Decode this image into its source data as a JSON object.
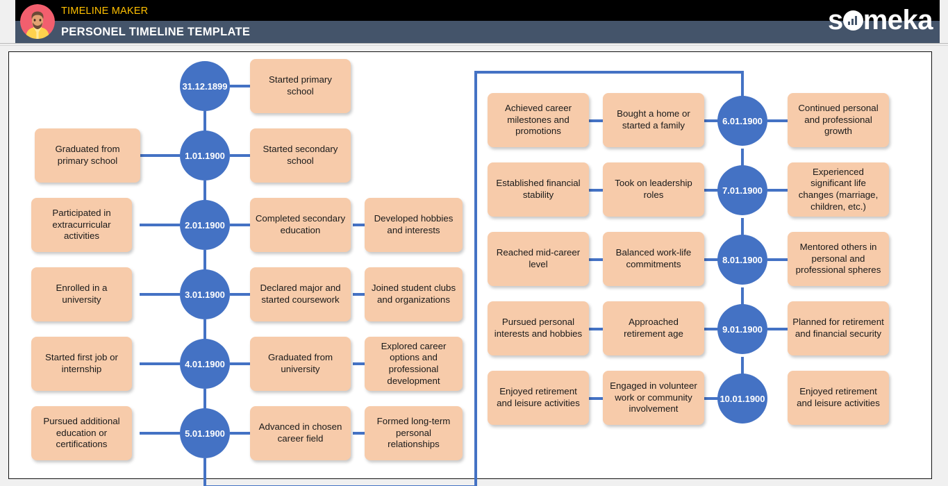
{
  "header": {
    "kicker": "TIMELINE MAKER",
    "title": "PERSONEL TIMELINE TEMPLATE",
    "brand_pre": "s",
    "brand_post": "meka",
    "avatar_icon": "user-avatar-icon",
    "colors": {
      "kicker": "#ffc000",
      "top_bar": "#000000",
      "title_bar": "#44546a",
      "brand_text": "#ffffff"
    }
  },
  "theme": {
    "node_fill": "#4472c4",
    "node_text": "#ffffff",
    "box_fill": "#f7cbaa",
    "box_text": "#1a1a1a",
    "connector": "#4472c4",
    "canvas": "#ffffff",
    "page": "#f0f0f0"
  },
  "timeline": {
    "left_column": [
      {
        "date": "31.12.1899",
        "left_box": "",
        "right_boxes": [
          "Started primary school"
        ]
      },
      {
        "date": "1.01.1900",
        "left_box": "Graduated from primary school",
        "right_boxes": [
          "Started secondary school"
        ]
      },
      {
        "date": "2.01.1900",
        "left_box": "Participated in extracurricular activities",
        "right_boxes": [
          "Completed secondary education",
          "Developed hobbies and interests"
        ]
      },
      {
        "date": "3.01.1900",
        "left_box": "Enrolled in a university",
        "right_boxes": [
          "Declared major and started coursework",
          "Joined student clubs and organizations"
        ]
      },
      {
        "date": "4.01.1900",
        "left_box": "Started first job or internship",
        "right_boxes": [
          "Graduated from university",
          "Explored career options and professional development"
        ]
      },
      {
        "date": "5.01.1900",
        "left_box": "Pursued additional education or certifications",
        "right_boxes": [
          "Advanced in chosen career field",
          "Formed long-term personal relationships"
        ]
      }
    ],
    "right_column": [
      {
        "date": "6.01.1900",
        "left_boxes": [
          "Achieved career milestones and promotions",
          "Bought a home or started a family"
        ],
        "right_box": "Continued personal and professional growth"
      },
      {
        "date": "7.01.1900",
        "left_boxes": [
          "Established financial stability",
          "Took on leadership roles"
        ],
        "right_box": "Experienced significant life changes (marriage, children, etc.)"
      },
      {
        "date": "8.01.1900",
        "left_boxes": [
          "Reached mid-career level",
          "Balanced work-life commitments"
        ],
        "right_box": "Mentored others in personal and professional spheres"
      },
      {
        "date": "9.01.1900",
        "left_boxes": [
          "Pursued personal interests and hobbies",
          "Approached retirement age"
        ],
        "right_box": "Planned for retirement and financial security"
      },
      {
        "date": "10.01.1900",
        "left_boxes": [
          "Enjoyed retirement and leisure activities",
          "Engaged in volunteer work or community involvement"
        ],
        "right_box": "Enjoyed retirement and leisure activities"
      }
    ]
  }
}
